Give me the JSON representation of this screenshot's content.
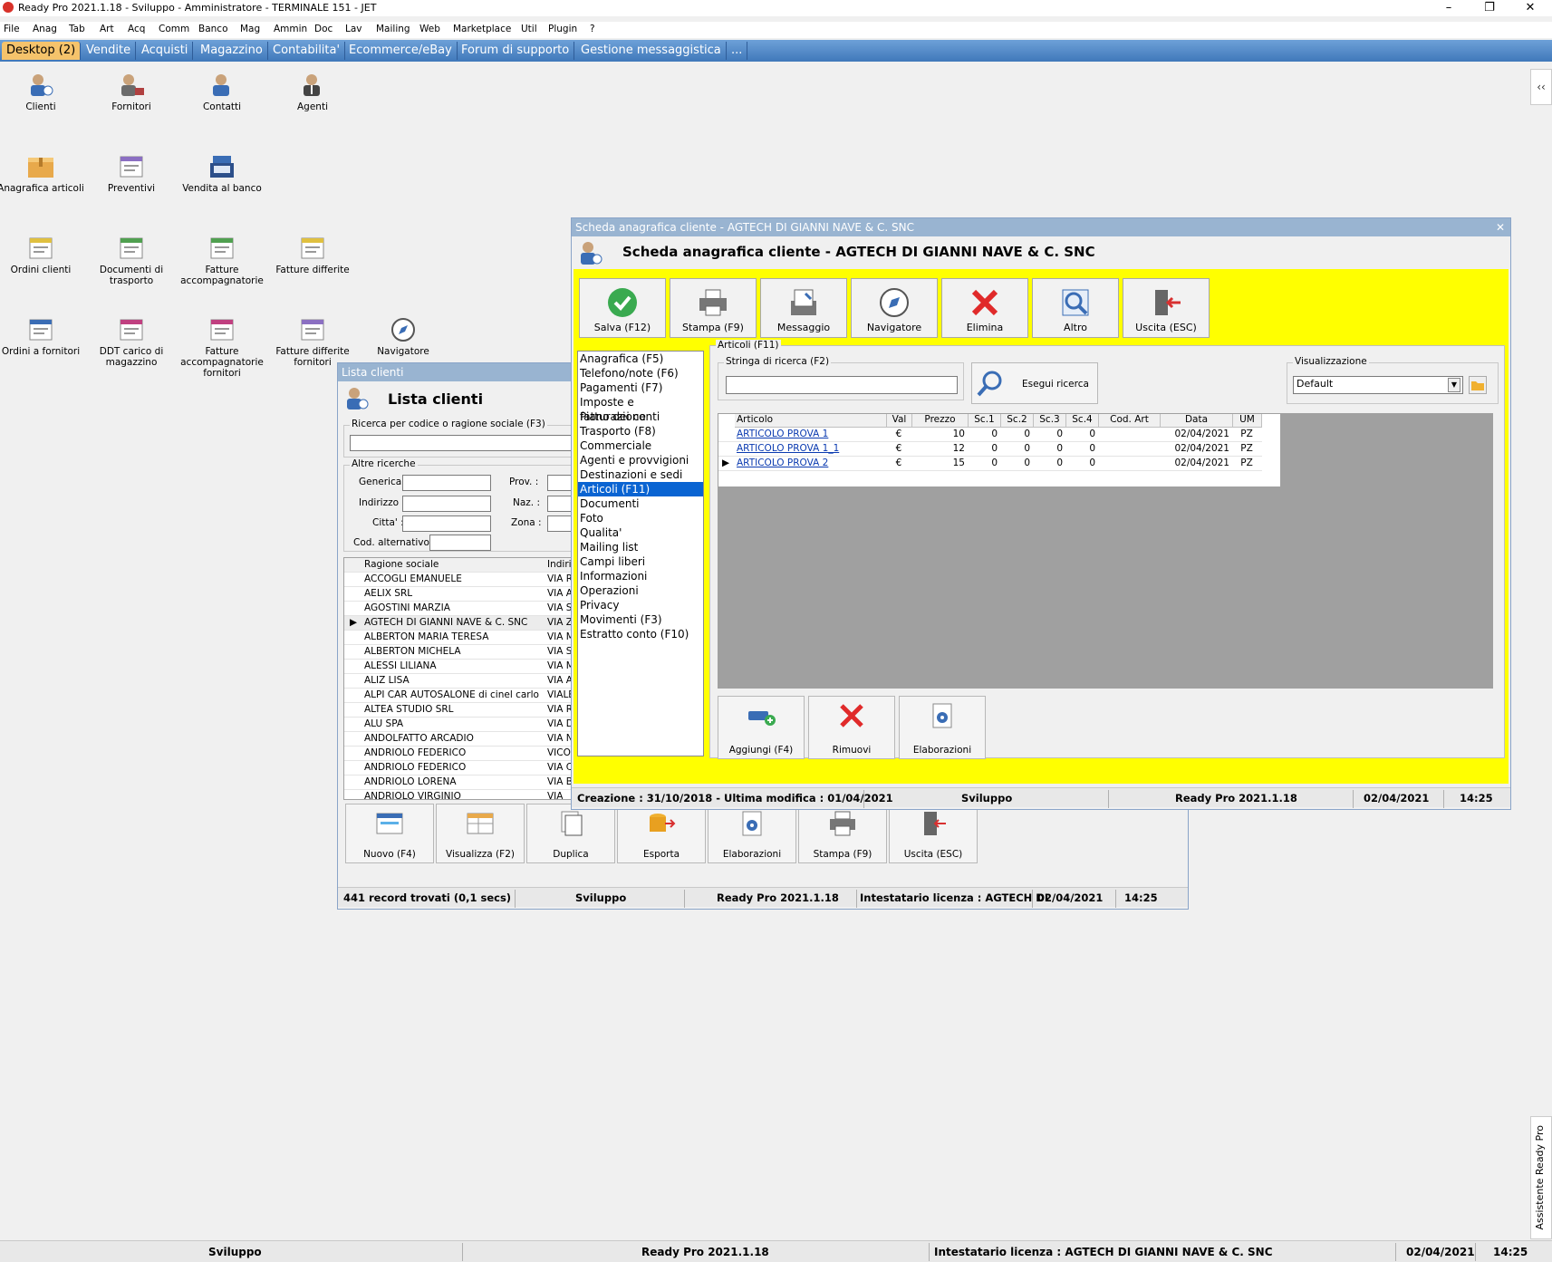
{
  "titlebar": {
    "title": "Ready Pro 2021.1.18 - Sviluppo - Amministratore - TERMINALE 151 - JET",
    "minimize": "–",
    "restore": "❐",
    "close": "✕"
  },
  "menu": [
    "File",
    "Anag",
    "Tab",
    "Art",
    "Acq",
    "Comm",
    "Banco",
    "Mag",
    "Ammin",
    "Doc",
    "Lav",
    "Mailing",
    "Web",
    "Marketplace",
    "Util",
    "Plugin",
    "?"
  ],
  "tabs": [
    "Desktop (2)",
    "Vendite",
    "Acquisti",
    "Magazzino",
    "Contabilita'",
    "Ecommerce/eBay",
    "Forum di supporto",
    "Gestione messaggistica",
    "..."
  ],
  "desktop_icons": [
    {
      "label": "Clienti",
      "icon": "clients-icon"
    },
    {
      "label": "Fornitori",
      "icon": "suppliers-icon"
    },
    {
      "label": "Contatti",
      "icon": "contacts-icon"
    },
    {
      "label": "Agenti",
      "icon": "agents-icon"
    },
    {
      "label": "Anagrafica articoli",
      "icon": "box-icon"
    },
    {
      "label": "Preventivi",
      "icon": "quote-icon"
    },
    {
      "label": "Vendita al banco",
      "icon": "cash-register-icon"
    },
    {
      "label": "Ordini clienti",
      "icon": "order-icon"
    },
    {
      "label": "Documenti di trasporto",
      "icon": "transport-doc-icon"
    },
    {
      "label": "Fatture accompagnatorie",
      "icon": "invoice-icon"
    },
    {
      "label": "Fatture differite",
      "icon": "deferred-invoice-icon"
    },
    {
      "label": "Ordini a fornitori",
      "icon": "supplier-order-icon"
    },
    {
      "label": "DDT carico di magazzino",
      "icon": "ddt-icon"
    },
    {
      "label": "Fatture accompagnatorie fornitori",
      "icon": "supplier-invoice-icon"
    },
    {
      "label": "Fatture differite fornitori",
      "icon": "supplier-deferred-invoice-icon"
    },
    {
      "label": "Navigatore",
      "icon": "compass-icon"
    }
  ],
  "side": {
    "collapse": "‹‹",
    "assistant": "Assistente Ready Pro"
  },
  "statusbar": {
    "env": "Sviluppo",
    "version": "Ready Pro 2021.1.18",
    "license": "Intestatario licenza : AGTECH DI GIANNI NAVE & C. SNC",
    "date": "02/04/2021",
    "time": "14:25"
  },
  "lista": {
    "wintitle": "Lista clienti",
    "header": "Lista clienti",
    "search_legend": "Ricerca per codice o ragione sociale (F3)",
    "altre_legend": "Altre ricerche",
    "labels": {
      "generica": "Generica :",
      "prov": "Prov. :",
      "indirizzo": "Indirizzo :",
      "naz": "Naz. :",
      "citta": "Citta' :",
      "zona": "Zona :",
      "codalt": "Cod. alternativo :"
    },
    "columns": [
      "Ragione sociale",
      "Indiriz"
    ],
    "rows": [
      [
        "ACCOGLI EMANUELE",
        "VIA R"
      ],
      [
        "AELIX SRL",
        "VIA A"
      ],
      [
        "AGOSTINI MARZIA",
        "VIA S"
      ],
      [
        "AGTECH DI GIANNI NAVE & C. SNC",
        "VIA Z"
      ],
      [
        "ALBERTON MARIA TERESA",
        "VIA M"
      ],
      [
        "ALBERTON MICHELA",
        "VIA S"
      ],
      [
        "ALESSI    LILIANA",
        "VIA M"
      ],
      [
        "ALIZ LISA",
        "VIA A"
      ],
      [
        "ALPI CAR AUTOSALONE di cinel carlo",
        "VIALE"
      ],
      [
        "ALTEA STUDIO SRL",
        "VIA R"
      ],
      [
        "ALU  SPA",
        "VIA D"
      ],
      [
        "ANDOLFATTO ARCADIO",
        "VIA N"
      ],
      [
        "ANDRIOLO FEDERICO",
        "VICOI"
      ],
      [
        "ANDRIOLO FEDERICO",
        "VIA C"
      ],
      [
        "ANDRIOLO LORENA",
        "VIA B"
      ],
      [
        "ANDRIOLO VIRGINIO",
        "VIA"
      ]
    ],
    "buttons": [
      "Nuovo (F4)",
      "Visualizza (F2)",
      "Duplica",
      "Esporta",
      "Elaborazioni",
      "Stampa (F9)",
      "Uscita (ESC)"
    ],
    "status": {
      "count": "441 record trovati (0,1 secs)",
      "env": "Sviluppo",
      "version": "Ready Pro 2021.1.18",
      "license": "Intestatario licenza : AGTECH DI",
      "date": "02/04/2021",
      "time": "14:25"
    }
  },
  "scheda": {
    "wintitle": "Scheda anagrafica cliente - AGTECH DI GIANNI NAVE & C. SNC",
    "header": "Scheda anagrafica cliente - AGTECH DI GIANNI NAVE & C. SNC",
    "close": "✕",
    "toolbar": [
      "Salva (F12)",
      "Stampa (F9)",
      "Messaggio",
      "Navigatore",
      "Elimina",
      "Altro",
      "Uscita (ESC)"
    ],
    "nav": [
      "Anagrafica (F5)",
      "Telefono/note (F6)",
      "Pagamenti (F7)",
      "Imposte e fatturazione",
      "Piano dei conti",
      "Trasporto (F8)",
      "Commerciale",
      "Agenti e provvigioni",
      "Destinazioni e sedi",
      "Articoli (F11)",
      "Documenti",
      "Foto",
      "Qualita'",
      "Mailing list",
      "Campi liberi",
      "Informazioni",
      "Operazioni",
      "Privacy",
      "Movimenti (F3)",
      "Estratto conto (F10)"
    ],
    "nav_selected": "Articoli (F11)",
    "panel_legend": "Articoli (F11)",
    "search_legend": "Stringa di ricerca (F2)",
    "search_button": "Esegui ricerca",
    "view_legend": "Visualizzazione",
    "view_value": "Default",
    "columns": [
      "Articolo",
      "Val",
      "Prezzo",
      "Sc.1",
      "Sc.2",
      "Sc.3",
      "Sc.4",
      "Cod. Art",
      "Data",
      "UM"
    ],
    "rows": [
      [
        "ARTICOLO PROVA 1",
        "€",
        "10",
        "0",
        "0",
        "0",
        "0",
        "",
        "02/04/2021",
        "PZ"
      ],
      [
        "ARTICOLO PROVA 1_1",
        "€",
        "12",
        "0",
        "0",
        "0",
        "0",
        "",
        "02/04/2021",
        "PZ"
      ],
      [
        "ARTICOLO PROVA 2",
        "€",
        "15",
        "0",
        "0",
        "0",
        "0",
        "",
        "02/04/2021",
        "PZ"
      ]
    ],
    "bottom_buttons": [
      "Aggiungi (F4)",
      "Rimuovi",
      "Elaborazioni"
    ],
    "status": {
      "dates": "Creazione : 31/10/2018 - Ultima modifica : 01/04/2021",
      "env": "Sviluppo",
      "version": "Ready Pro 2021.1.18",
      "date": "02/04/2021",
      "time": "14:25"
    }
  },
  "colors": {
    "tabbar": "#4f87c6",
    "active_tab": "#f5c36b",
    "yellow_panel": "#ffff00",
    "selection": "#0a64d2",
    "title_inactive": "#99b4d1"
  }
}
